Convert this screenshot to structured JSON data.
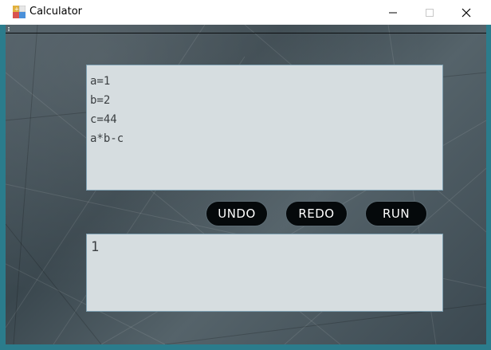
{
  "window": {
    "title": "Calculator",
    "icon": "calculator-app-icon",
    "controls": [
      "minimize-icon",
      "maximize-icon",
      "close-icon"
    ]
  },
  "input": {
    "lines": [
      "a=1",
      "b=2",
      "c=44",
      "a*b-c"
    ]
  },
  "toolbar": {
    "undo_label": "UNDO",
    "redo_label": "REDO",
    "run_label": "RUN"
  },
  "output": {
    "value": "1"
  },
  "colors": {
    "button_bg": "#05090b",
    "text_area_bg": "#d6dde0",
    "text_area_border": "#7ea0b2"
  }
}
